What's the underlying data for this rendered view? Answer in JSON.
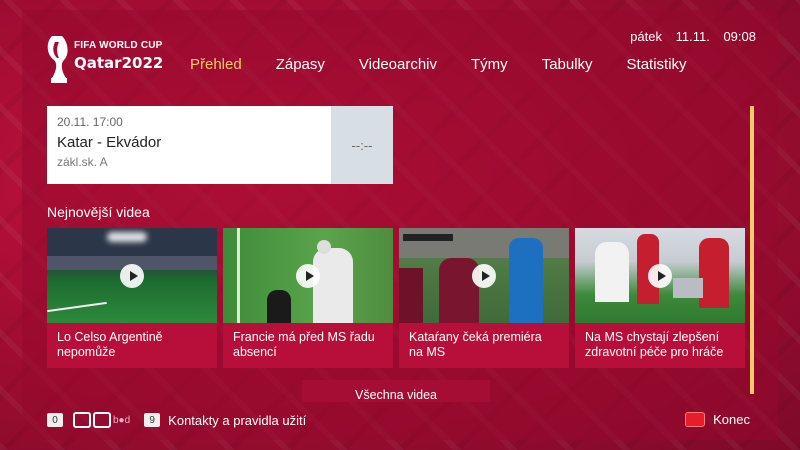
{
  "brand": {
    "line1": "FIFA WORLD CUP",
    "line2": "Qatar2022"
  },
  "clock": {
    "day": "pátek",
    "date": "11.11.",
    "time": "09:08"
  },
  "nav": {
    "tabs": [
      {
        "label": "Přehled",
        "active": true
      },
      {
        "label": "Zápasy"
      },
      {
        "label": "Videoarchiv"
      },
      {
        "label": "Týmy"
      },
      {
        "label": "Tabulky"
      },
      {
        "label": "Statistiky"
      }
    ]
  },
  "match": {
    "datetime": "20.11. 17:00",
    "teams": "Katar - Ekvádor",
    "group": "zákl.sk. A",
    "score": "--:--"
  },
  "latest": {
    "title": "Nejnovější videa",
    "videos": [
      {
        "title": "Lo Celso Argentině nepomůže"
      },
      {
        "title": "Francie má před MS řadu absencí"
      },
      {
        "title": "Kataŕany čeká premiéra na MS"
      },
      {
        "title": "Na MS chystají zlepšení zdravotní péče pro hráče"
      }
    ],
    "all_label": "Všechna videa"
  },
  "footer": {
    "key0": "0",
    "ct_suffix": "b●d",
    "key9": "9",
    "contacts": "Kontakty a pravidla užití",
    "exit": "Konec"
  },
  "colors": {
    "accent": "#f6c96b",
    "background": "#a50d33",
    "exit_button": "#e81c2d"
  }
}
